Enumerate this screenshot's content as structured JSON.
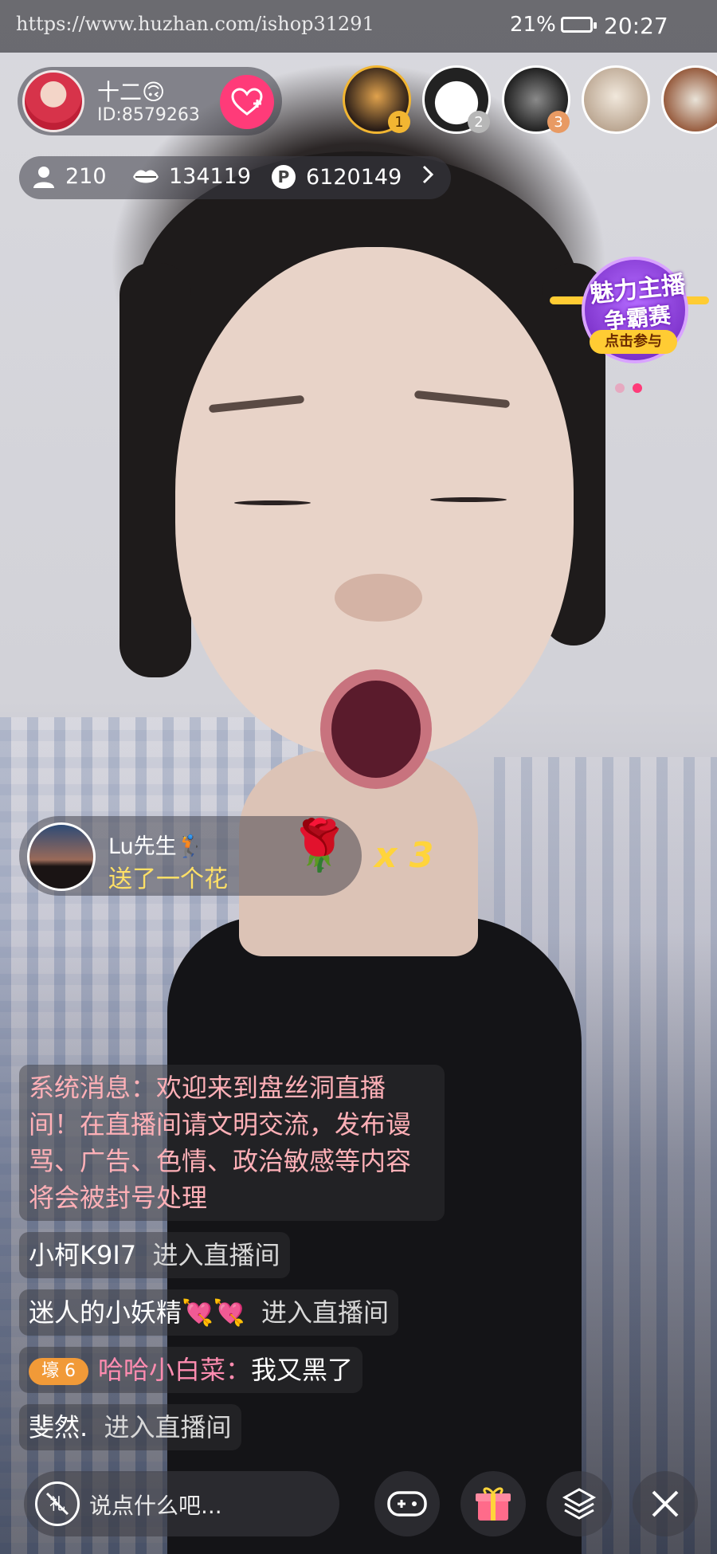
{
  "status_bar": {
    "url": "https://www.huzhan.com/ishop31291",
    "battery": "21%",
    "time": "20:27"
  },
  "host": {
    "name": "十二🙃",
    "id": "ID:8579263",
    "follow_icon": "heart-plus-icon"
  },
  "top_viewers": [
    {
      "rank": "1",
      "badge_color": "#f2b632"
    },
    {
      "rank": "2",
      "badge_color": "#b7b7b7"
    },
    {
      "rank": "3",
      "badge_color": "#e89a63"
    },
    {
      "rank": ""
    },
    {
      "rank": ""
    }
  ],
  "stats": {
    "online": "210",
    "likes": "134119",
    "coins": "6120149"
  },
  "contest_banner": {
    "line1": "魅力主播",
    "line2": "争霸赛",
    "button": "点击参与"
  },
  "gift_notice": {
    "user": "Lu先生🏌",
    "text": "送了一个花",
    "combo": "x 3",
    "gift_icon": "rose-icon"
  },
  "chat": {
    "system": "系统消息：欢迎来到盘丝洞直播间！在直播间请文明交流，发布谩骂、广告、色情、政治敏感等内容将会被封号处理",
    "messages": [
      {
        "name": "小柯K9I7",
        "text": "进入直播间"
      },
      {
        "name": "迷人的小妖精💘💘",
        "text": "进入直播间"
      },
      {
        "level": "壕 6",
        "name": "哈哈小白菜：",
        "text": "我又黑了"
      },
      {
        "name": "斐然.",
        "text": "进入直播间"
      }
    ]
  },
  "bottom_bar": {
    "placeholder": "说点什么吧...",
    "icons": [
      "no-gift-icon",
      "gamepad-icon",
      "gift-icon",
      "layers-icon",
      "close-icon"
    ]
  },
  "colors": {
    "follow": "#ff3b79",
    "combo": "#ffd43b",
    "system_text": "#ffb0b7",
    "level_badge": "#f19a38"
  }
}
